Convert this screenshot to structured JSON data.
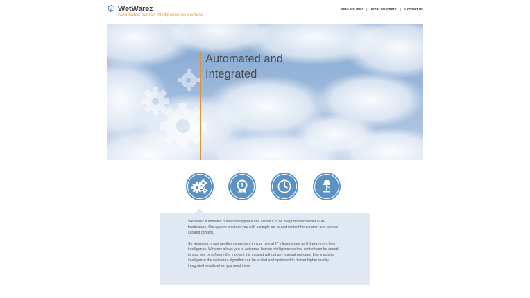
{
  "brand": {
    "name": "WetWarez",
    "tagline": "Automated human intelligence on demand"
  },
  "nav": {
    "items": [
      "Who are we?",
      "What we offer?",
      "Contact us"
    ],
    "separator": "|"
  },
  "hero": {
    "title_line1": "Automated and",
    "title_line2": "Integrated"
  },
  "features": [
    {
      "icon": "gears-icon"
    },
    {
      "icon": "award-badge-icon"
    },
    {
      "icon": "clock-icon"
    },
    {
      "icon": "lamp-icon"
    }
  ],
  "panel": {
    "paragraph1": "Wetwarez automates human intelligence and allows it to be integrated into wider IT in-frastructure. Our system provides you with a simple api to add content for curation and receive curated content.",
    "paragraph2": "So wetwarez is just another component in your overall IT infrastructure as if it were ma-chine intelligence. Wetwarz allows you to automate human intelligence so that content can be added to your site or software the moment it is curated without any manual pro-cess. Like machine intelligence the wetwarez algorithm can be scaled and optimised to deliver higher quality integrated results when you need them."
  },
  "colors": {
    "accent": "#e8922e",
    "icon_blue": "#5b92c2",
    "panel_bg": "#dfe8f3"
  }
}
